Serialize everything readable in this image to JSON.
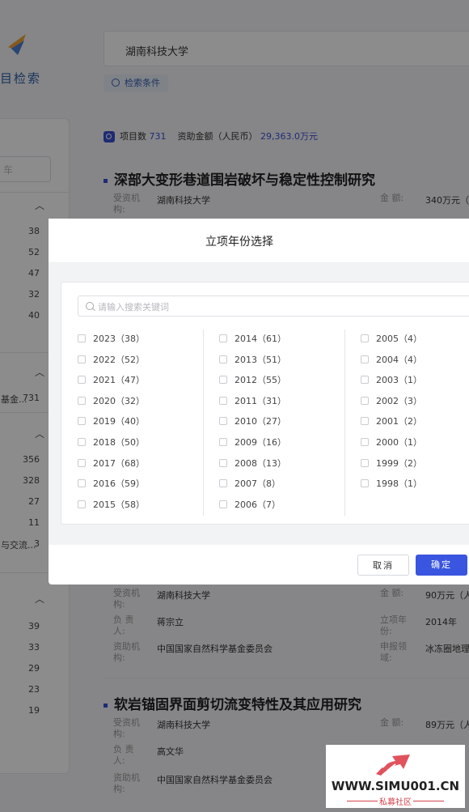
{
  "logo": {
    "text": "目检索"
  },
  "search": {
    "query": "湖南科技大学"
  },
  "conditions_label": "检索条件",
  "stats": {
    "count_label": "项目数",
    "count": "731",
    "amount_label": "资助金额（人民币）",
    "amount": "29,363.0万元"
  },
  "sidebar": {
    "input_placeholder": "车",
    "group1": [
      "38",
      "52",
      "47",
      "32",
      "40"
    ],
    "group2": [
      {
        "label": "基金...",
        "count": "731"
      }
    ],
    "group3": [
      {
        "label": "",
        "count": "356"
      },
      {
        "label": "",
        "count": "328"
      },
      {
        "label": "",
        "count": "27"
      },
      {
        "label": "",
        "count": "11"
      },
      {
        "label": "与交流...",
        "count": "3"
      }
    ],
    "group4": [
      "39",
      "33",
      "29",
      "23",
      "19"
    ]
  },
  "results": [
    {
      "title": "深部大变形巷道围岩破坏与稳定性控制研究",
      "fields": [
        {
          "label": "受资机构:",
          "value": "湖南科技大学"
        },
        {
          "label": "金    额:",
          "value": "340万元（"
        }
      ]
    },
    {
      "title": "",
      "fields": [
        {
          "label": "受资机构:",
          "value": "湖南科技大学"
        },
        {
          "label": "负 责 人:",
          "value": "蒋宗立"
        },
        {
          "label": "资助机构:",
          "value": "中国国家自然科学基金委员会"
        },
        {
          "label": "金    额:",
          "value": "90万元（人"
        },
        {
          "label": "立项年份:",
          "value": "2014年"
        },
        {
          "label": "申报领域:",
          "value": "冰冻圈地理"
        }
      ]
    },
    {
      "title": "软岩锚固界面剪切流变特性及其应用研究",
      "fields": [
        {
          "label": "受资机构:",
          "value": "湖南科技大学"
        },
        {
          "label": "负 责 人:",
          "value": "高文华"
        },
        {
          "label": "资助机构:",
          "value": "中国国家自然科学基金委员会"
        },
        {
          "label": "金    额:",
          "value": "89万元（人"
        }
      ]
    }
  ],
  "modal": {
    "title": "立项年份选择",
    "keyword_placeholder": "请输入搜索关键词",
    "years": [
      "2023（38）",
      "2022（52）",
      "2021（47）",
      "2020（32）",
      "2019（40）",
      "2018（50）",
      "2017（68）",
      "2016（59）",
      "2015（58）",
      "2014（61）",
      "2013（51）",
      "2012（55）",
      "2011（31）",
      "2010（27）",
      "2009（16）",
      "2008（13）",
      "2007（8）",
      "2006（7）",
      "2005（4）",
      "2004（4）",
      "2003（1）",
      "2002（3）",
      "2001（2）",
      "2000（1）",
      "1999（2）",
      "1998（1）"
    ],
    "cancel_label": "取消",
    "confirm_label": "确定"
  },
  "watermark": {
    "text": "WWW.SIMU001.CN",
    "sub": "私募社区"
  }
}
